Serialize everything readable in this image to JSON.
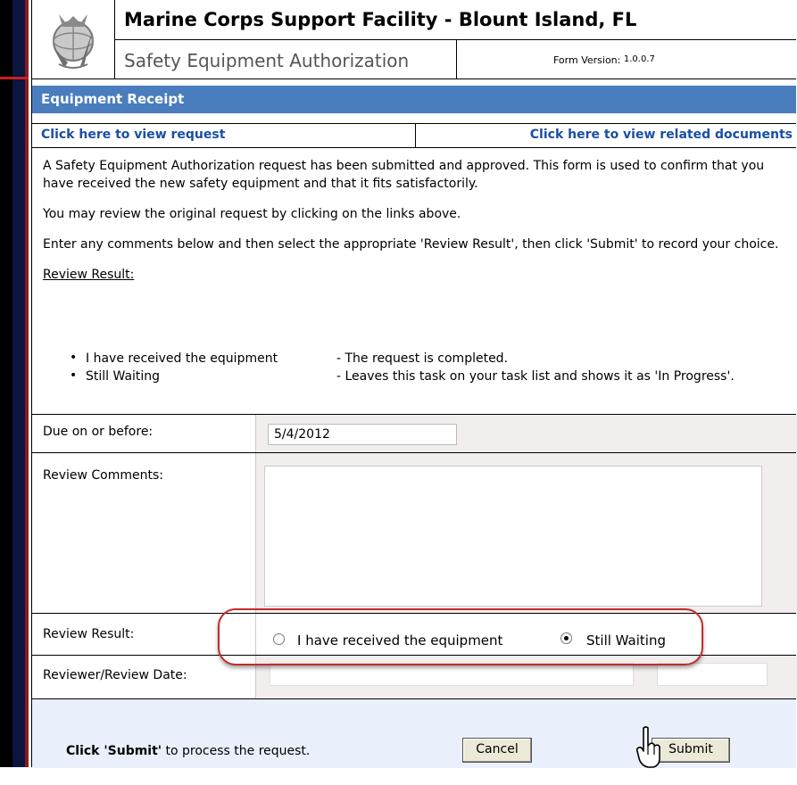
{
  "header": {
    "title": "Marine Corps Support Facility - Blount Island, FL",
    "subtitle": "Safety Equipment Authorization",
    "version_label": "Form Version:",
    "version": "1.0.0.7"
  },
  "section": {
    "title": "Equipment Receipt"
  },
  "links": {
    "view_request": "Click here to view request",
    "view_documents": "Click here to view related documents"
  },
  "instructions": {
    "p1": "A Safety Equipment Authorization request has been submitted and approved. This form is used to confirm that you have received the new safety equipment and that it fits satisfactorily.",
    "p2": "You may review the original request by clicking on the links above.",
    "p3": "Enter any comments below and then select the appropriate 'Review Result', then click 'Submit' to record your choice.",
    "review_result_heading": "Review Result:",
    "options": [
      {
        "name": "I have received the equipment",
        "desc": "- The request is completed."
      },
      {
        "name": "Still Waiting",
        "desc": "- Leaves this task on your task list and shows it as 'In Progress'."
      }
    ]
  },
  "fields": {
    "due_label": "Due on or before:",
    "due_value": "5/4/2012",
    "comments_label": "Review Comments:",
    "comments_value": "",
    "result_label": "Review Result:",
    "result_option_received": "I have received the equipment",
    "result_option_waiting": "Still Waiting",
    "result_selected": "Still Waiting",
    "reviewer_label": "Reviewer/Review Date:",
    "reviewer_value": "",
    "review_date_value": ""
  },
  "footer": {
    "instruction_bold": "Click 'Submit'",
    "instruction_rest": " to process the request.",
    "cancel_label": "Cancel",
    "submit_label": "Submit"
  },
  "colors": {
    "section_bar": "#4a7dbd",
    "link": "#1a4fa3",
    "highlight": "#c62b2b"
  }
}
